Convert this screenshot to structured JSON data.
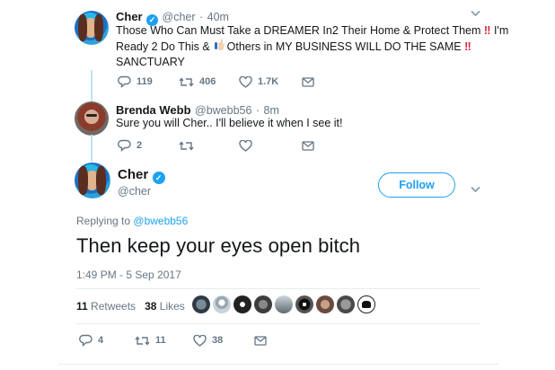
{
  "colors": {
    "accent": "#1da1f2",
    "muted": "#657786",
    "thread": "#bfe3f7",
    "divider": "#e6ecf0"
  },
  "tweet1": {
    "name": "Cher",
    "handle": "@cher",
    "time": "40m",
    "text_line1": "Those Who Can Must Take a DREAMER In2 Their Home & Protect Them",
    "text_line2_a": "I'm",
    "text_line2_b": "Ready 2 Do This &",
    "text_line2_c": "Others in MY BUSINESS WILL DO THE SAME",
    "text_line3": "SANCTUARY",
    "bang": "‼",
    "replies": "119",
    "retweets": "406",
    "likes": "1.7K"
  },
  "tweet2": {
    "name": "Brenda Webb",
    "handle": "@bwebb56",
    "time": "8m",
    "text": "Sure you will Cher.. I'll believe it when I see it!",
    "replies": "2"
  },
  "main": {
    "name": "Cher",
    "handle": "@cher",
    "follow_label": "Follow",
    "replying_prefix": "Replying to",
    "replying_to": "@bwebb56",
    "text": "Then keep your eyes open bitch",
    "date": "1:49 PM - 5 Sep 2017",
    "retweets_count": "11",
    "retweets_label": "Retweets",
    "likes_count": "38",
    "likes_label": "Likes",
    "action_replies": "4",
    "action_retweets": "11",
    "action_likes": "38"
  },
  "icons": [
    "reply-icon",
    "retweet-icon",
    "like-icon",
    "dm-icon",
    "verified-icon",
    "chevron-down-icon"
  ]
}
